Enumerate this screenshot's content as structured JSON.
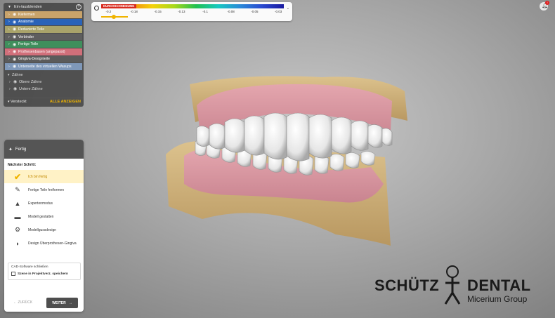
{
  "visibility_panel": {
    "title": "Ein-/ausblenden",
    "layers": [
      {
        "label": "Kiefermen",
        "color": "#c9a36a"
      },
      {
        "label": "Anatomie",
        "color": "#2a63b8"
      },
      {
        "label": "Reduzierte Teile",
        "color": "#a9a36a"
      },
      {
        "label": "Verbinder",
        "color": "#5e5e5e"
      },
      {
        "label": "Fertige Teile",
        "color": "#3f8f5c"
      },
      {
        "label": "Prothesenbasen (angepasst)",
        "color": "#d16f7a"
      },
      {
        "label": "Gingiva-Designteile",
        "color": "#5b5b5b"
      },
      {
        "label": "Unterseite des virtuellen Wasups",
        "color": "#7f98b9"
      }
    ],
    "teeth_group": {
      "label": "Zähne",
      "items": [
        "Obere Zähne",
        "Untere Zähne"
      ]
    },
    "footer_label": "Versteckt",
    "show_all_label": "ALLE ANZEIGEN",
    "help_icon": "question-circle-icon"
  },
  "color_scale": {
    "title": "DURCHSCHNEIDUNG",
    "ticks": [
      "-0.2",
      "-0.18",
      "-0.15",
      "-0.13",
      "-0.1",
      "-0.08",
      "-0.05",
      "-0.03"
    ],
    "slider_value": "0.2",
    "colors": [
      "#e02020",
      "#f07a10",
      "#f4d20a",
      "#a8d81a",
      "#20c050",
      "#16c8c0",
      "#2a8ad8",
      "#2a4ad0",
      "#1a1aa0"
    ]
  },
  "notification": {
    "badge": "!"
  },
  "wizard": {
    "title": "Fertig",
    "next_step_label": "Nächster Schritt:",
    "steps": [
      {
        "label": "Ich bin fertig",
        "icon": "check-icon",
        "active": true
      },
      {
        "label": "Fertige Teile freiformen",
        "icon": "freeform-tool-icon",
        "active": false
      },
      {
        "label": "Expertenmodus",
        "icon": "expert-hat-icon",
        "active": false
      },
      {
        "label": "Modell gestalten",
        "icon": "model-design-icon",
        "active": false
      },
      {
        "label": "Modellgussdesign",
        "icon": "cast-design-icon",
        "active": false
      },
      {
        "label": "Design Überprothesen-Gingiva",
        "icon": "gingiva-design-icon",
        "active": false
      }
    ],
    "close_cad_label": "CAD-Software schließen",
    "save_scene_label": "Szene in Projektverz. speichern",
    "back_label": "ZURÜCK",
    "next_label": "WEITER"
  },
  "logo": {
    "word1": "SCHÜTZ",
    "word2": "DENTAL",
    "subtitle": "Micerium Group"
  }
}
